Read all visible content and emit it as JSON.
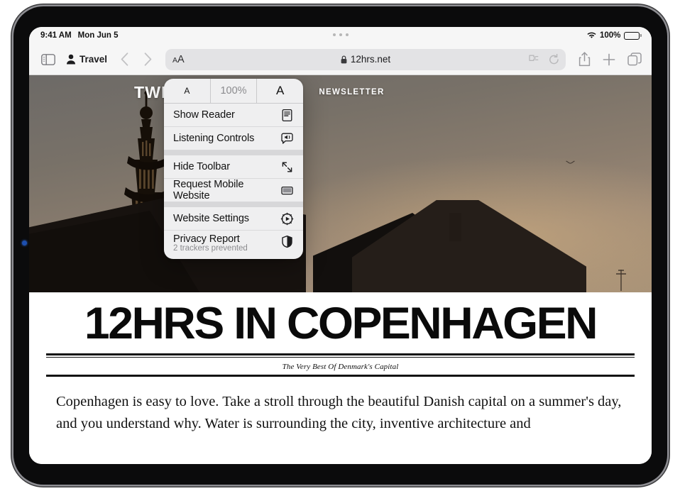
{
  "status_bar": {
    "time": "9:41 AM",
    "date": "Mon Jun 5",
    "battery_percent": "100%",
    "wifi_icon": "wifi-icon",
    "battery_icon": "battery-icon"
  },
  "toolbar": {
    "sidebar_icon": "sidebar-icon",
    "profile_icon": "person-icon",
    "profile_label": "Travel",
    "back_icon": "chevron-left-icon",
    "forward_icon": "chevron-right-icon",
    "aa_small": "A",
    "aa_large": "A",
    "lock_icon": "lock-icon",
    "url": "12hrs.net",
    "extensions_icon": "puzzle-icon",
    "reload_icon": "reload-icon",
    "share_icon": "share-icon",
    "new_tab_icon": "plus-icon",
    "tabs_icon": "tabs-overview-icon"
  },
  "aa_menu": {
    "zoom_out_label": "A",
    "zoom_level": "100%",
    "zoom_in_label": "A",
    "items": [
      {
        "label": "Show Reader",
        "icon": "reader-icon"
      },
      {
        "label": "Listening Controls",
        "icon": "speaker-message-icon"
      },
      {
        "label": "Hide Toolbar",
        "icon": "arrows-expand-icon"
      },
      {
        "label": "Request Mobile Website",
        "icon": "mobile-display-icon"
      },
      {
        "label": "Website Settings",
        "icon": "gear-play-icon"
      },
      {
        "label": "Privacy Report",
        "sublabel": "2 trackers prevented",
        "icon": "shield-icon"
      }
    ]
  },
  "site": {
    "logo": "TWELVEHOURS",
    "newsletter_link": "NEWSLETTER"
  },
  "article": {
    "headline": "12HRS IN COPENHAGEN",
    "subtitle": "The Very Best Of Denmark's Capital",
    "body": "Copenhagen is easy to love. Take a stroll through the beautiful Danish capital on a summer's day, and you understand why. Water is surrounding the city, inventive architecture and"
  }
}
